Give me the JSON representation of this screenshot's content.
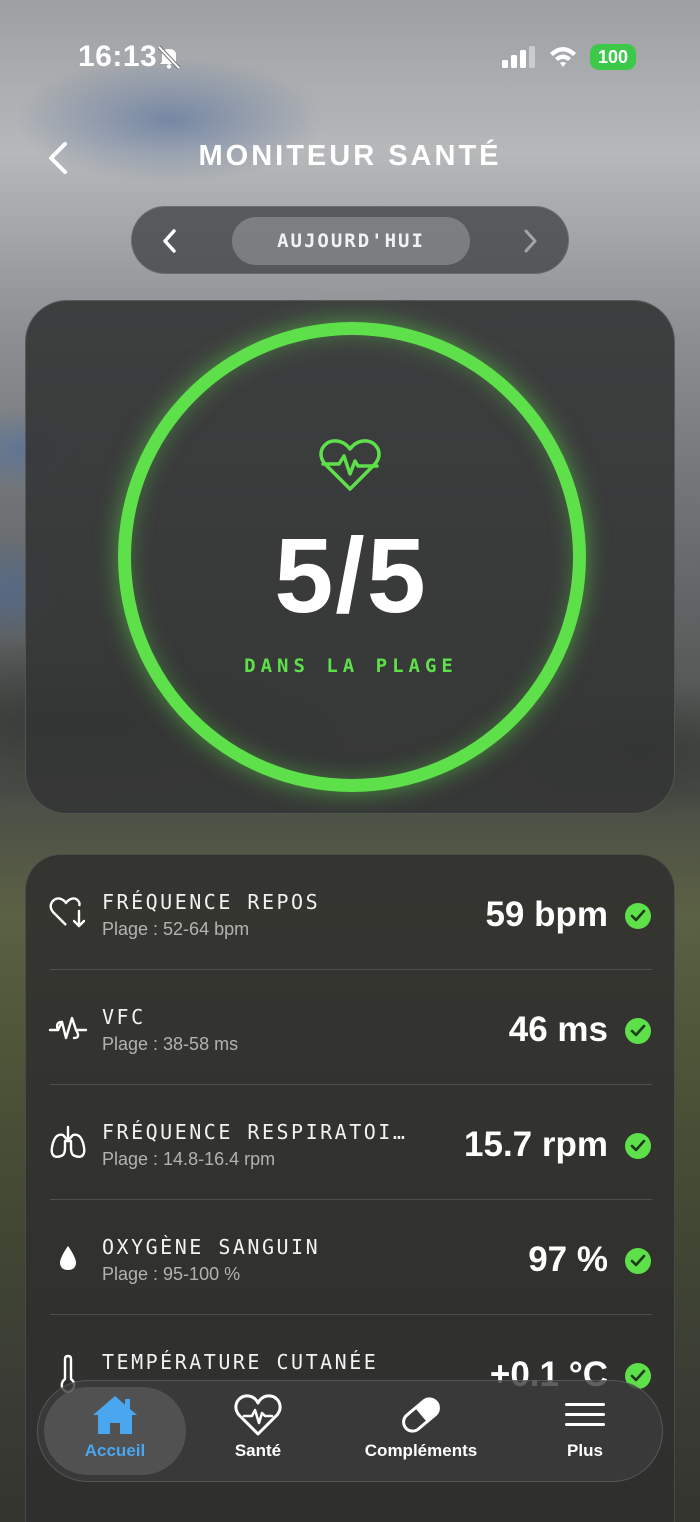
{
  "status_bar": {
    "time": "16:13",
    "battery": "100"
  },
  "header": {
    "title": "MONITEUR SANTÉ"
  },
  "date_switcher": {
    "label": "AUJOURD'HUI"
  },
  "score": {
    "value": "5/5",
    "label": "DANS LA PLAGE",
    "ring_color": "#5ee04a"
  },
  "metrics": [
    {
      "icon": "heart-down-icon",
      "name": "FRÉQUENCE REPOS",
      "range": "Plage : 52-64 bpm",
      "value": "59 bpm",
      "in_range": true
    },
    {
      "icon": "hrv-wave-icon",
      "name": "VFC",
      "range": "Plage : 38-58 ms",
      "value": "46 ms",
      "in_range": true
    },
    {
      "icon": "lungs-icon",
      "name": "FRÉQUENCE RESPIRATOI…",
      "range": "Plage : 14.8-16.4 rpm",
      "value": "15.7 rpm",
      "in_range": true
    },
    {
      "icon": "drop-icon",
      "name": "OXYGÈNE SANGUIN",
      "range": "Plage : 95-100 %",
      "value": "97 %",
      "in_range": true
    },
    {
      "icon": "thermometer-icon",
      "name": "TEMPÉRATURE CUTANÉE",
      "range": "",
      "value": "+0.1 °C",
      "in_range": true
    }
  ],
  "tabs": [
    {
      "icon": "home-icon",
      "label": "Accueil",
      "active": true
    },
    {
      "icon": "heart-pulse-icon",
      "label": "Santé",
      "active": false
    },
    {
      "icon": "pill-icon",
      "label": "Compléments",
      "active": false
    },
    {
      "icon": "menu-icon",
      "label": "Plus",
      "active": false
    }
  ],
  "colors": {
    "accent_green": "#5ee04a",
    "active_tab": "#4aa6ee",
    "battery": "#3cc94a"
  }
}
